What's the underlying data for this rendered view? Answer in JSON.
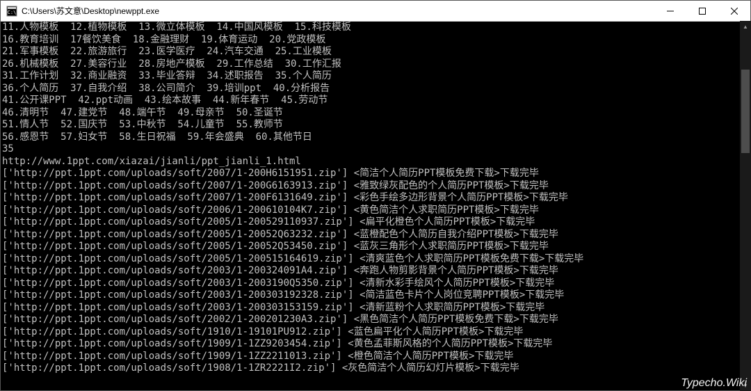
{
  "title": "C:\\Users\\苏文意\\Desktop\\newppt.exe",
  "watermark": "Typecho.Wiki",
  "rows": [
    [
      "11.人物模板",
      "12.植物模板",
      "13.微立体模板",
      "14.中国风模板",
      "15.科技模板"
    ],
    [
      "16.教育培训",
      "17餐饮美食",
      "18.金融理财",
      "19.体育运动",
      "20.党政模板"
    ],
    [
      "21.军事模板",
      "22.旅游旅行",
      "23.医学医疗",
      "24.汽车交通",
      "25.工业模板"
    ],
    [
      "26.机械模板",
      "27.美容行业",
      "28.房地产模板",
      "29.工作总结",
      "30.工作汇报"
    ],
    [
      "31.工作计划",
      "32.商业融资",
      "33.毕业答辩",
      "34.述职报告",
      "35.个人简历"
    ],
    [
      "36.个人简历",
      "37.自我介绍",
      "38.公司简介",
      "39.培训ppt",
      "40.分析报告"
    ],
    [
      "41.公开课PPT",
      "42.ppt动画",
      "43.绘本故事",
      "44.新年春节",
      "45.劳动节"
    ],
    [
      "46.清明节",
      "47.建党节",
      "48.端午节",
      "49.母亲节",
      "50.圣诞节"
    ],
    [
      "51.情人节",
      "52.国庆节",
      "53.中秋节",
      "54.儿童节",
      "55.教师节"
    ],
    [
      "56.感恩节",
      "57.妇女节",
      "58.生日祝福",
      "59.年会盛典",
      "60.其他节日"
    ]
  ],
  "choice": "35",
  "sourceUrl": "http://www.1ppt.com/xiazai/jianli/ppt_jianli_1.html",
  "downloads": [
    {
      "url": "http://ppt.1ppt.com/uploads/soft/2007/1-200H6151951.zip",
      "desc": "简洁个人简历PPT模板免费下载",
      "status": "下载完毕"
    },
    {
      "url": "http://ppt.1ppt.com/uploads/soft/2007/1-200G6163913.zip",
      "desc": "雅致绿灰配色的个人简历PPT模板",
      "status": "下载完毕"
    },
    {
      "url": "http://ppt.1ppt.com/uploads/soft/2007/1-200F6131649.zip",
      "desc": "彩色手绘多边形背景个人简历PPT模板",
      "status": "下载完毕"
    },
    {
      "url": "http://ppt.1ppt.com/uploads/soft/2006/1-200610104K7.zip",
      "desc": "黄色简洁个人求职简历PPT模板",
      "status": "下载完毕"
    },
    {
      "url": "http://ppt.1ppt.com/uploads/soft/2005/1-200529110937.zip",
      "desc": "扁平化橙色个人简历PPT模板",
      "status": "下载完毕"
    },
    {
      "url": "http://ppt.1ppt.com/uploads/soft/2005/1-20052Q63232.zip",
      "desc": "蓝橙配色个人简历自我介绍PPT模板",
      "status": "下载完毕"
    },
    {
      "url": "http://ppt.1ppt.com/uploads/soft/2005/1-20052Q53450.zip",
      "desc": "蓝灰三角形个人求职简历PPT模板",
      "status": "下载完毕"
    },
    {
      "url": "http://ppt.1ppt.com/uploads/soft/2005/1-200515164619.zip",
      "desc": "清爽蓝色个人求职简历PPT模板免费下载",
      "status": "下载完毕"
    },
    {
      "url": "http://ppt.1ppt.com/uploads/soft/2003/1-200324091A4.zip",
      "desc": "奔跑人物剪影背景个人简历PPT模板",
      "status": "下载完毕"
    },
    {
      "url": "http://ppt.1ppt.com/uploads/soft/2003/1-2003190Q5350.zip",
      "desc": "清新水彩手绘风个人简历PPT模板",
      "status": "下载完毕"
    },
    {
      "url": "http://ppt.1ppt.com/uploads/soft/2003/1-200303192328.zip",
      "desc": "简洁蓝色卡片个人岗位竞聘PPT模板",
      "status": "下载完毕"
    },
    {
      "url": "http://ppt.1ppt.com/uploads/soft/2003/1-200303153159.zip",
      "desc": "清新蓝粉个人求职简历PPT模板",
      "status": "下载完毕"
    },
    {
      "url": "http://ppt.1ppt.com/uploads/soft/2002/1-200201230A3.zip",
      "desc": "黑色简洁个人简历PPT模板免费下载",
      "status": "下载完毕"
    },
    {
      "url": "http://ppt.1ppt.com/uploads/soft/1910/1-19101PU912.zip",
      "desc": "蓝色扁平化个人简历PPT模板",
      "status": "下载完毕"
    },
    {
      "url": "http://ppt.1ppt.com/uploads/soft/1909/1-1ZZ9203454.zip",
      "desc": "黄色孟菲斯风格的个人简历PPT模板",
      "status": "下载完毕"
    },
    {
      "url": "http://ppt.1ppt.com/uploads/soft/1909/1-1ZZ2211013.zip",
      "desc": "橙色简洁个人简历PPT模板",
      "status": "下载完毕"
    },
    {
      "url": "http://ppt.1ppt.com/uploads/soft/1908/1-1ZR2221I2.zip",
      "desc": "灰色简洁个人简历幻灯片模板",
      "status": "下载完毕"
    }
  ]
}
